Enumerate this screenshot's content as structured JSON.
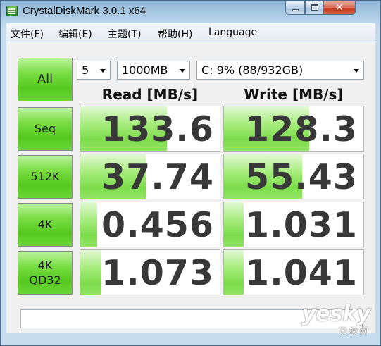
{
  "window": {
    "title": "CrystalDiskMark 3.0.1 x64",
    "close_glyph": "✕"
  },
  "menu": {
    "items": [
      {
        "label": "文件(F)"
      },
      {
        "label": "编辑(E)"
      },
      {
        "label": "主题(T)"
      },
      {
        "label": "帮助(H)"
      },
      {
        "label": "Language"
      }
    ]
  },
  "controls": {
    "all_label": "All",
    "count": "5",
    "size": "1000MB",
    "drive": "C: 9% (88/932GB)"
  },
  "headers": {
    "read": "Read [MB/s]",
    "write": "Write [MB/s]"
  },
  "tests": [
    {
      "label": "Seq",
      "read": "133.6",
      "write": "128.3",
      "read_fill": 0.62,
      "write_fill": 0.61
    },
    {
      "label": "512K",
      "read": "37.74",
      "write": "55.43",
      "read_fill": 0.47,
      "write_fill": 0.56
    },
    {
      "label": "4K",
      "read": "0.456",
      "write": "1.031",
      "read_fill": 0.12,
      "write_fill": 0.14
    },
    {
      "label": "4K QD32",
      "label_line1": "4K",
      "label_line2": "QD32",
      "read": "1.073",
      "write": "1.041",
      "read_fill": 0.15,
      "write_fill": 0.14
    }
  ],
  "status_text": "",
  "watermark": {
    "brand": "yesky",
    "sub": "天极网"
  },
  "colors": {
    "button_green": "#79de43",
    "bar_green": "#7cdc4a",
    "window_frame": "#c6dbec"
  }
}
